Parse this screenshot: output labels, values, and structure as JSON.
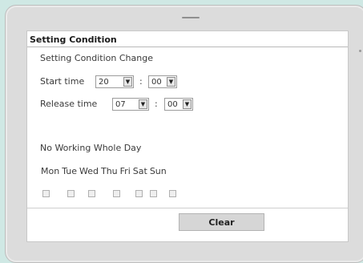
{
  "section": {
    "title": "Setting Condition"
  },
  "form": {
    "heading": "Setting Condition Change",
    "start": {
      "label": "Start time",
      "hour": "20",
      "minute": "00",
      "separator": ":"
    },
    "release": {
      "label": "Release time",
      "hour": "07",
      "minute": "00",
      "separator": ":"
    },
    "no_working_label": "No Working Whole Day",
    "days": [
      "Mon",
      "Tue",
      "Wed",
      "Thu",
      "Fri",
      "Sat",
      "Sun"
    ],
    "day_checked": [
      false,
      false,
      false,
      false,
      false,
      false,
      false
    ]
  },
  "actions": {
    "clear_label": "Clear"
  },
  "icons": {
    "dropdown": "chevron-down-icon"
  },
  "colors": {
    "background": "#cfe8e4",
    "device": "#dcdcdc",
    "button": "#d6d6d6"
  }
}
